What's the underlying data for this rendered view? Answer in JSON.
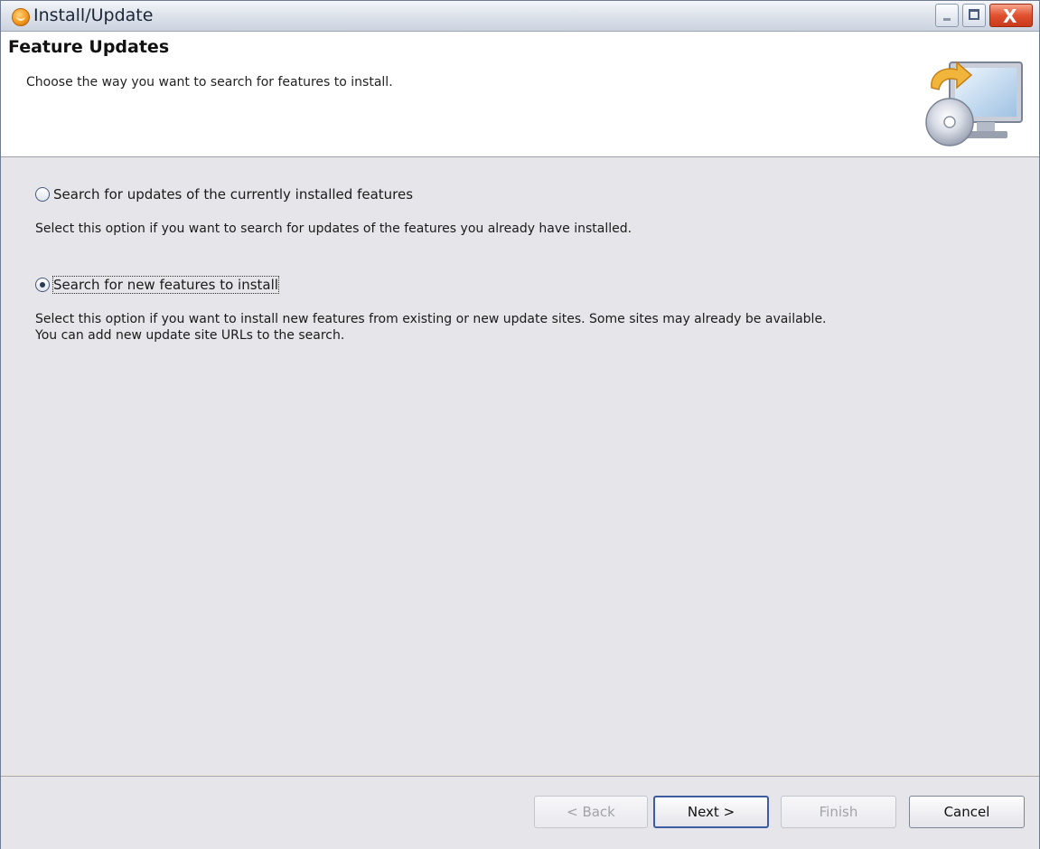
{
  "window": {
    "title": "Install/Update",
    "controls": [
      "minimize",
      "maximize",
      "close"
    ],
    "close_glyph": "X"
  },
  "banner": {
    "title": "Feature Updates",
    "description": "Choose the way you want to search for features to install.",
    "image_icon": "monitor-with-cd-update-icon"
  },
  "options": [
    {
      "label": "Search for updates of the currently installed features",
      "selected": false,
      "description": "Select this option if you want to search for updates of the features you already have installed."
    },
    {
      "label": "Search for new features to install",
      "selected": true,
      "description_line1": "Select this option if you want to install new features from existing or new update sites. Some sites may already be available.",
      "description_line2": "You can add new update site URLs to the search."
    }
  ],
  "buttons": {
    "back": "< Back",
    "next": "Next >",
    "finish": "Finish",
    "cancel": "Cancel"
  },
  "colors": {
    "dialog_background": "#e6e6ea",
    "banner_background": "#ffffff",
    "close_button": "#d94a2a",
    "default_button_border": "#3d5ca0"
  }
}
